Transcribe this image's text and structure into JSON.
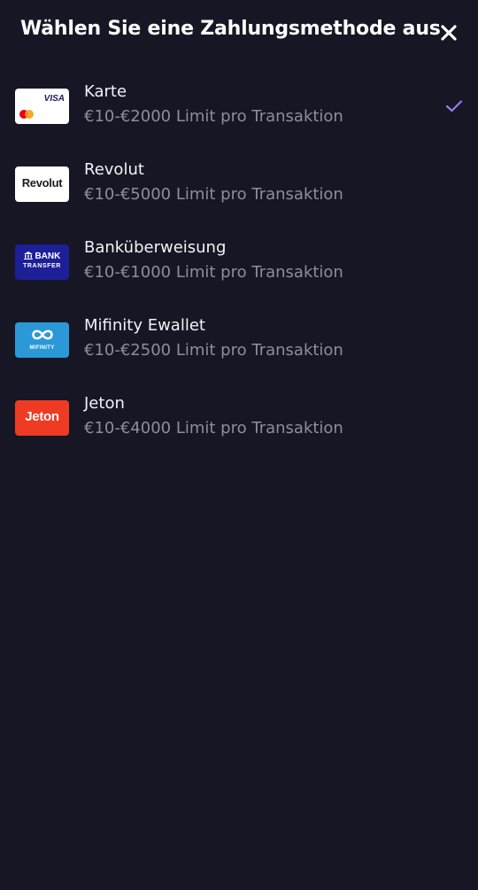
{
  "header": {
    "title": "Wählen Sie eine Zahlungsmethode aus",
    "close_icon": "close-icon"
  },
  "colors": {
    "background": "#161624",
    "title": "#ffffff",
    "method_name": "#f2f2f7",
    "limit_text": "#8d8d9c",
    "check": "#9b7be8"
  },
  "methods": [
    {
      "name": "Karte",
      "limit": "€10-€2000 Limit pro Transaktion",
      "logo_text": "VISA",
      "selected": true
    },
    {
      "name": "Revolut",
      "limit": "€10-€5000 Limit pro Transaktion",
      "logo_text": "Revolut",
      "selected": false
    },
    {
      "name": "Banküberweisung",
      "limit": "€10-€1000 Limit pro Transaktion",
      "logo_text": "BANK",
      "logo_subtext": "TRANSFER",
      "selected": false
    },
    {
      "name": "Mifinity Ewallet",
      "limit": "€10-€2500 Limit pro Transaktion",
      "logo_text": "MIFINITY",
      "selected": false
    },
    {
      "name": "Jeton",
      "limit": "€10-€4000 Limit pro Transaktion",
      "logo_text": "Jeton",
      "selected": false
    }
  ]
}
